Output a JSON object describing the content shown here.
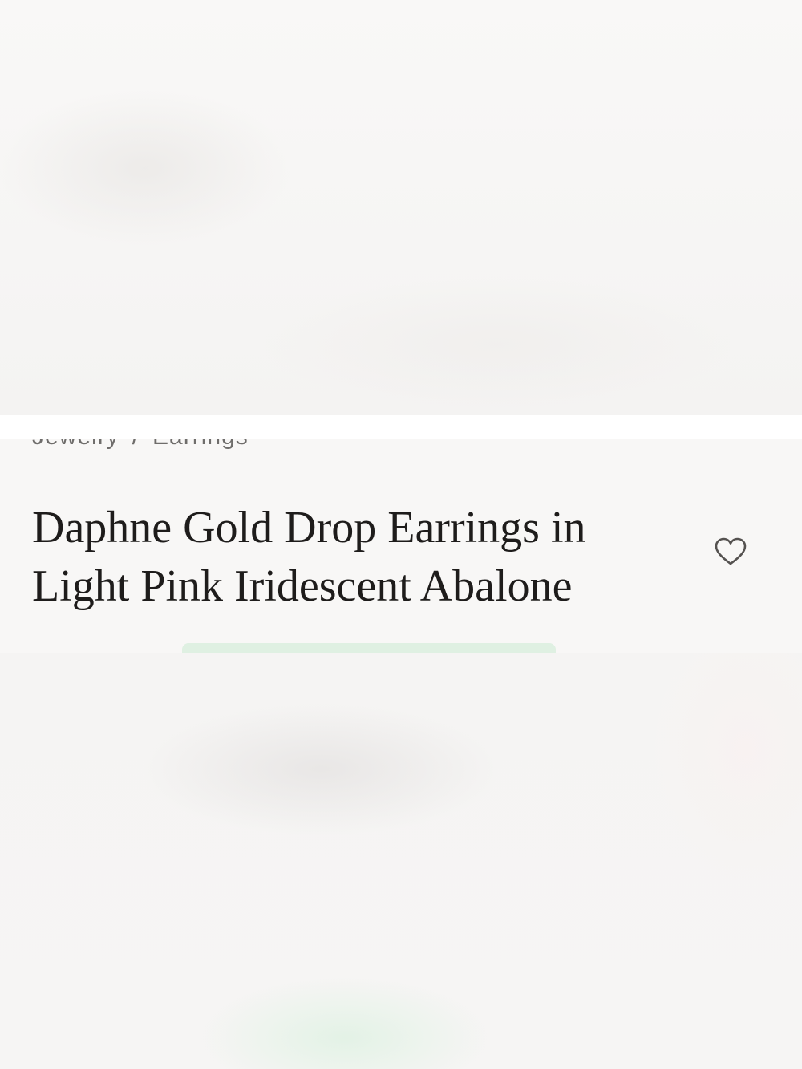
{
  "breadcrumb": {
    "items": [
      "Jewelry",
      "Earrings"
    ],
    "separator": "/"
  },
  "product": {
    "title": "Daphne Gold Drop Earrings in Light Pink Iridescent Abalone"
  },
  "wishlist": {
    "icon": "heart-outline-icon"
  },
  "colors": {
    "promo_strip": "#dff0e2",
    "divider": "#8e8c8a",
    "title_text": "#1e1c1b"
  }
}
